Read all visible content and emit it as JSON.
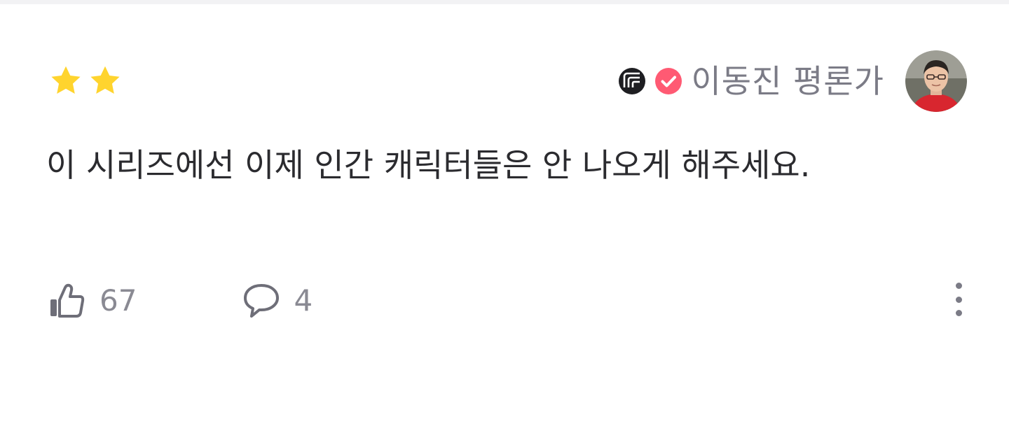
{
  "rating": {
    "stars_filled": 2,
    "star_color": "#ffd42e"
  },
  "author": {
    "badge_icon": "critic-badge-icon",
    "verified_icon": "verified-check-icon",
    "verified_color": "#ff5a73",
    "name": "이동진 평론가"
  },
  "review": {
    "text": "이 시리즈에선 이제 인간 캐릭터들은 안 나오게 해주세요."
  },
  "actions": {
    "like_count": "67",
    "comment_count": "4",
    "like_icon": "thumbs-up-icon",
    "comment_icon": "speech-bubble-icon",
    "more_icon": "more-vertical-icon"
  },
  "colors": {
    "text_primary": "#2b2b2f",
    "text_secondary": "#7b7b86",
    "icon": "#6e6e78"
  }
}
